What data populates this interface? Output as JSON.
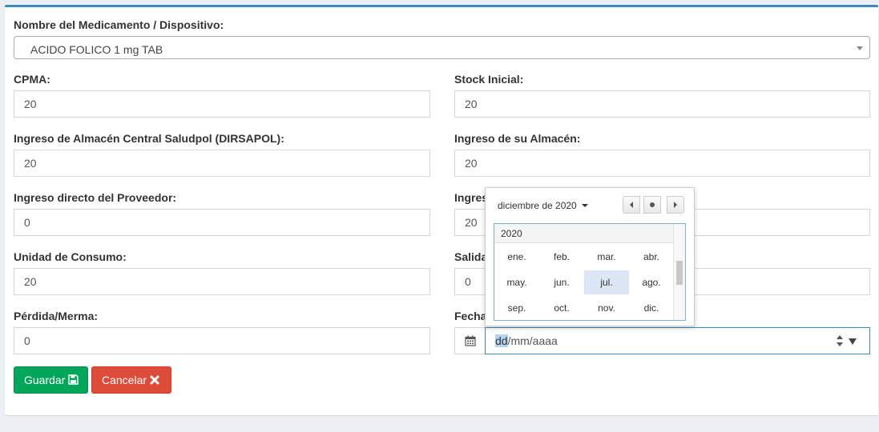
{
  "form": {
    "med_label": "Nombre del Medicamento / Dispositivo:",
    "med_value": "ACIDO FOLICO 1 mg TAB",
    "cpma_label": "CPMA:",
    "cpma_value": "20",
    "stock_label": "Stock Inicial:",
    "stock_value": "20",
    "ingreso_central_label": "Ingreso de Almacén Central Saludpol (DIRSAPOL):",
    "ingreso_central_value": "20",
    "ingreso_almacen_label": "Ingreso de su Almacén:",
    "ingreso_almacen_value": "20",
    "ingreso_proveedor_label": "Ingreso directo del Proveedor:",
    "ingreso_proveedor_value": "0",
    "ingreso_otro_label_partial": "Ingres",
    "ingreso_otro_value": "20",
    "unidad_label": "Unidad de Consumo:",
    "unidad_value": "20",
    "salida_label_partial": "Salida",
    "salida_value": "0",
    "perdida_label": "Pérdida/Merma:",
    "perdida_value": "0",
    "fecha_label_partial": "Fecha",
    "fecha_seg_day": "dd",
    "fecha_seg_rest": "/mm/aaaa"
  },
  "buttons": {
    "save": "Guardar",
    "cancel": "Cancelar"
  },
  "datepicker": {
    "title": "diciembre de 2020",
    "year": "2020",
    "months": [
      "ene.",
      "feb.",
      "mar.",
      "abr.",
      "may.",
      "jun.",
      "jul.",
      "ago.",
      "sep.",
      "oct.",
      "nov.",
      "dic."
    ],
    "selected_month": "jul."
  },
  "colors": {
    "accent": "#3c8dbc",
    "save": "#00a65a",
    "cancel": "#dd4b39"
  }
}
